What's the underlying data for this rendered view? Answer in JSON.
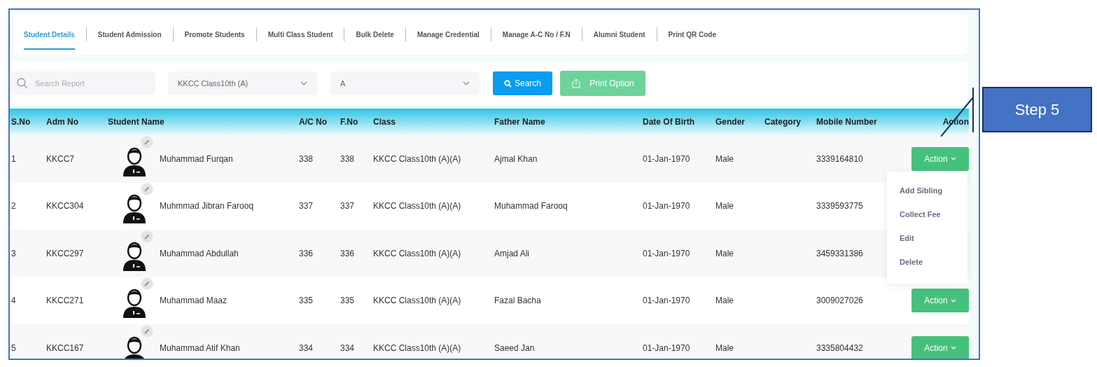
{
  "tabs": [
    {
      "label": "Student Details",
      "selected": true
    },
    {
      "label": "Student Admission",
      "selected": false
    },
    {
      "label": "Promote Students",
      "selected": false
    },
    {
      "label": "Multi Class Student",
      "selected": false
    },
    {
      "label": "Bulk Delete",
      "selected": false
    },
    {
      "label": "Manage Credential",
      "selected": false
    },
    {
      "label": "Manage A-C No / F.N",
      "selected": false
    },
    {
      "label": "Alumni Student",
      "selected": false
    },
    {
      "label": "Print QR Code",
      "selected": false
    }
  ],
  "filters": {
    "search": {
      "placeholder": "Search Report"
    },
    "class_select": {
      "value": "KKCC Class10th (A)"
    },
    "section_select": {
      "value": "A"
    },
    "search_button": "Search",
    "print_button": "Print Option"
  },
  "table": {
    "columns": [
      "S.No",
      "Adm No",
      "Student Name",
      "A/C No",
      "F.No",
      "Class",
      "Father Name",
      "Date Of Birth",
      "Gender",
      "Category",
      "Mobile Number",
      "Action"
    ],
    "rows": [
      {
        "sno": "1",
        "adm_no": "KKCC7",
        "name": "Muhammad Furqan",
        "ac_no": "338",
        "f_no": "338",
        "class": "KKCC Class10th (A)(A)",
        "father": "Ajmal Khan",
        "dob": "01-Jan-1970",
        "gender": "Male",
        "mobile": "3339164810",
        "action": "Action"
      },
      {
        "sno": "2",
        "adm_no": "KKCC304",
        "name": "Muhmmad Jibran Farooq",
        "ac_no": "337",
        "f_no": "337",
        "class": "KKCC Class10th (A)(A)",
        "father": "Muhammad Farooq",
        "dob": "01-Jan-1970",
        "gender": "Male",
        "mobile": "3339593775"
      },
      {
        "sno": "3",
        "adm_no": "KKCC297",
        "name": "Muhammad Abdullah",
        "ac_no": "336",
        "f_no": "336",
        "class": "KKCC Class10th (A)(A)",
        "father": "Amjad Ali",
        "dob": "01-Jan-1970",
        "gender": "Male",
        "mobile": "3459331386"
      },
      {
        "sno": "4",
        "adm_no": "KKCC271",
        "name": "Muhammad Maaz",
        "ac_no": "335",
        "f_no": "335",
        "class": "KKCC Class10th (A)(A)",
        "father": "Fazal Bacha",
        "dob": "01-Jan-1970",
        "gender": "Male",
        "mobile": "3009027026",
        "action": "Action"
      },
      {
        "sno": "5",
        "adm_no": "KKCC167",
        "name": "Muhammad Atif Khan",
        "ac_no": "334",
        "f_no": "334",
        "class": "KKCC Class10th (A)(A)",
        "father": "Saeed Jan",
        "dob": "01-Jan-1970",
        "gender": "Male",
        "mobile": "3335804432",
        "action": "Action"
      }
    ]
  },
  "action_menu": {
    "open": true,
    "items": [
      "Add Sibling",
      "Collect Fee",
      "Edit",
      "Delete"
    ]
  },
  "callout": {
    "text": "Step 5"
  }
}
